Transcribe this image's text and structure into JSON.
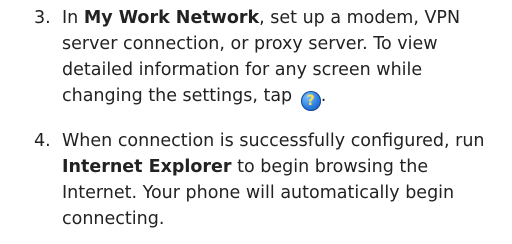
{
  "steps": [
    {
      "number": "3.",
      "parts": {
        "pre": "In ",
        "bold": "My Work Network",
        "mid": ", set up a modem, VPN server connection, or proxy server. To view detailed information for any screen while changing the settings, tap ",
        "post": "."
      },
      "icon": {
        "name": "help-icon",
        "glyph": "?"
      }
    },
    {
      "number": "4.",
      "parts": {
        "pre": "When connection is successfully configured, run ",
        "bold": "Internet Explorer",
        "post": " to begin browsing the Internet. Your phone will automatically begin connecting."
      }
    }
  ]
}
